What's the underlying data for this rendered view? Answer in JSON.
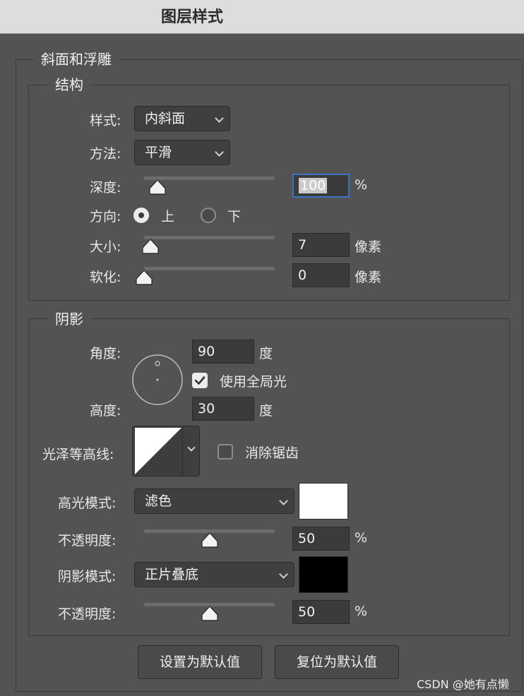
{
  "window": {
    "title": "图层样式"
  },
  "bevel": {
    "legend": "斜面和浮雕",
    "structure": {
      "legend": "结构",
      "style": {
        "label": "样式:",
        "value": "内斜面"
      },
      "technique": {
        "label": "方法:",
        "value": "平滑"
      },
      "depth": {
        "label": "深度:",
        "value": "100",
        "unit": "%",
        "slider": 0.1
      },
      "direction": {
        "label": "方向:",
        "up": "上",
        "down": "下",
        "selected": "上"
      },
      "size": {
        "label": "大小:",
        "value": "7",
        "unit": "像素",
        "slider": 0.05
      },
      "soften": {
        "label": "软化:",
        "value": "0",
        "unit": "像素",
        "slider": 0.0
      }
    },
    "shading": {
      "legend": "阴影",
      "angle": {
        "label": "角度:",
        "value": "90",
        "unit": "度"
      },
      "use_global": {
        "label": "使用全局光",
        "checked": true
      },
      "altitude": {
        "label": "高度:",
        "value": "30",
        "unit": "度"
      },
      "gloss_contour": {
        "label": "光泽等高线:"
      },
      "anti_alias": {
        "label": "消除锯齿",
        "checked": false
      },
      "highlight_mode": {
        "label": "高光模式:",
        "value": "滤色",
        "color": "#ffffff"
      },
      "highlight_opacity": {
        "label": "不透明度:",
        "value": "50",
        "unit": "%",
        "slider": 0.5
      },
      "shadow_mode": {
        "label": "阴影模式:",
        "value": "正片叠底",
        "color": "#000000"
      },
      "shadow_opacity": {
        "label": "不透明度:",
        "value": "50",
        "unit": "%",
        "slider": 0.5
      }
    }
  },
  "buttons": {
    "make_default": "设置为默认值",
    "reset_default": "复位为默认值"
  },
  "watermark": "CSDN @她有点懒"
}
